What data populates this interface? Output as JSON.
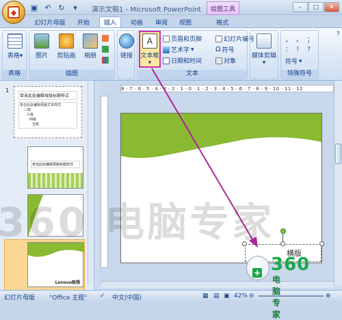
{
  "window": {
    "title": "演示文稿1 - Microsoft PowerPoint",
    "context_tab": "绘图工具",
    "controls": [
      "–",
      "□",
      "✕"
    ]
  },
  "tabs": [
    "幻灯片母版",
    "开始",
    "插入",
    "动画",
    "审阅",
    "视图",
    "格式"
  ],
  "active_tab": "插入",
  "ribbon": {
    "groups": {
      "table": {
        "label": "表格",
        "buttons": [
          "表格"
        ]
      },
      "illustrations": {
        "label": "插图",
        "buttons": [
          "图片",
          "剪贴画",
          "相册"
        ]
      },
      "links": {
        "buttons": [
          "链接"
        ]
      },
      "text": {
        "label": "文本",
        "textbox": "文本框",
        "items": [
          "页眉和页脚",
          "艺术字",
          "日期和时间",
          "幻灯片编号",
          "符号",
          "对象"
        ]
      },
      "media": {
        "buttons": [
          "媒体剪辑"
        ]
      },
      "special": {
        "label": "特殊符号",
        "symbols": [
          "，",
          "。",
          "；",
          "：",
          "！",
          "？"
        ],
        "more": "符号"
      }
    }
  },
  "thumbnails": [
    {
      "num": "1",
      "title": "单击此处编辑母版标题样式",
      "body": [
        "单击此处编辑母版文本样式",
        "二级",
        "三级",
        "四级",
        "五级"
      ]
    },
    {
      "num": "",
      "title": "单击此处编辑母版标题样式"
    },
    {
      "num": ""
    },
    {
      "num": "",
      "footer": "Lenovo联想"
    }
  ],
  "ruler_text": "8 · 7 · 6 · 5 · 4 · 3 · 2 · 1 · 0 · 1 · 2 · 3 · 4 · 5 · 6 · 7 · 8 · 9 · 10 · 11 · 12",
  "slide": {
    "textbox_text": "横版"
  },
  "status": {
    "view": "幻灯片母版",
    "theme": "\"Office 主题\"",
    "language": "中文(中国)",
    "zoom": "42%"
  },
  "watermark": {
    "text": "360 电脑专家",
    "brand": "360",
    "brand_sub": "电脑专家"
  },
  "colors": {
    "accent": "#8ab932",
    "highlight": "#d02ab0",
    "ribbon": "#dbe7f6"
  }
}
